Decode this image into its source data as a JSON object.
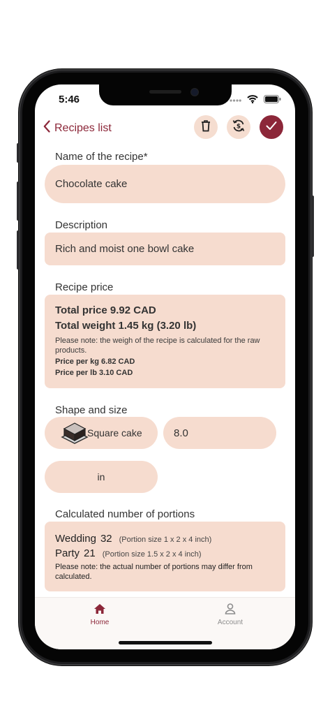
{
  "status_bar": {
    "time": "5:46"
  },
  "nav": {
    "back_label": "Recipes list",
    "icons": [
      "trash-icon",
      "sync-icon",
      "checkmark-icon"
    ]
  },
  "recipe_name": {
    "label": "Name of the recipe*",
    "value": "Chocolate cake"
  },
  "description": {
    "label": "Description",
    "value": "Rich and moist one bowl cake"
  },
  "recipe_price": {
    "label": "Recipe price",
    "total_price": "Total price 9.92 CAD",
    "total_weight": "Total weight 1.45 kg (3.20 lb)",
    "note": "Please note: the weigh of the recipe is calculated for the raw products.",
    "price_per_kg": "Price per kg 6.82 CAD",
    "price_per_lb": "Price per lb 3.10 CAD"
  },
  "shape_size": {
    "label": "Shape and size",
    "shape": "Square cake",
    "size": "8.0",
    "unit": "in"
  },
  "portions": {
    "label": "Calculated number of portions",
    "items": [
      {
        "name": "Wedding",
        "count": "32",
        "size": "(Portion size 1 x 2 x 4 inch)"
      },
      {
        "name": "Party",
        "count": "21",
        "size": "(Portion size 1.5 x 2 x 4 inch)"
      }
    ],
    "note": "Please note: the actual number of portions may differ from calculated."
  },
  "tabbar": {
    "home": "Home",
    "account": "Account"
  },
  "colors": {
    "accent": "#8c2739",
    "field_bg": "#f6dccf"
  }
}
